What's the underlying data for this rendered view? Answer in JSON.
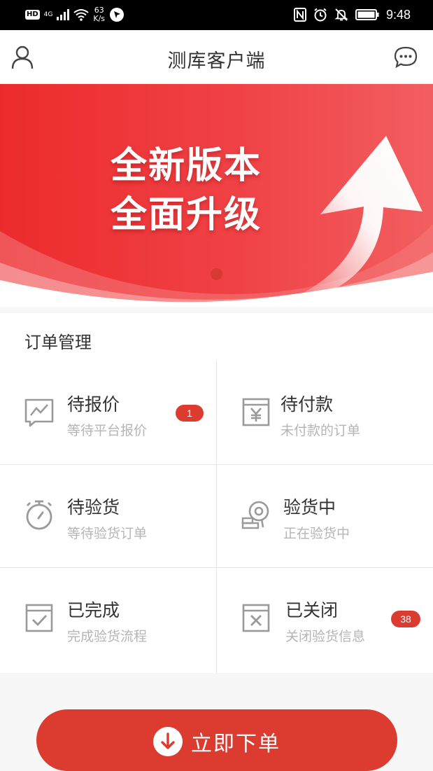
{
  "status_bar": {
    "hd": "HD",
    "network": "4G",
    "speed_value": "63",
    "speed_unit": "K/s",
    "time": "9:48"
  },
  "navbar": {
    "title": "测库客户端",
    "left_icon": "user-icon",
    "right_icon": "chat-bubble-icon"
  },
  "banner": {
    "line1": "全新版本",
    "line2": "全面升级",
    "slides": 1,
    "active_slide": 1
  },
  "orders": {
    "section_title": "订单管理",
    "items": [
      {
        "title": "待报价",
        "subtitle": "等待平台报价",
        "icon": "chart-frame-icon",
        "badge": "1"
      },
      {
        "title": "待付款",
        "subtitle": "未付款的订单",
        "icon": "yuan-box-icon",
        "badge": ""
      },
      {
        "title": "待验货",
        "subtitle": "等待验货订单",
        "icon": "stopwatch-icon",
        "badge": ""
      },
      {
        "title": "验货中",
        "subtitle": "正在验货中",
        "icon": "inspection-icon",
        "badge": ""
      },
      {
        "title": "已完成",
        "subtitle": "完成验货流程",
        "icon": "check-box-icon",
        "badge": ""
      },
      {
        "title": "已关闭",
        "subtitle": "关闭验货信息",
        "icon": "close-box-icon",
        "badge": "38"
      }
    ]
  },
  "cta": {
    "label": "立即下单",
    "icon": "arrow-down-circle-icon"
  },
  "colors": {
    "brand_red": "#db3c2f",
    "badge_red": "#dc3b30",
    "icon_gray": "#9a9a9a"
  }
}
